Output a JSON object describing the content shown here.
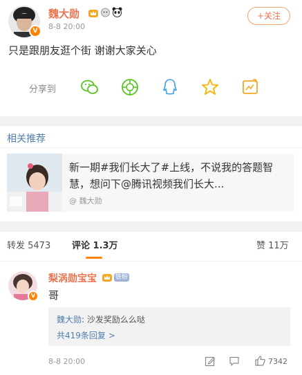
{
  "post": {
    "author": "魏大勋",
    "verified_icon": "orange-v-icon",
    "badges": [
      "vip-crown-icon",
      "sheep-icon",
      "panda-icon"
    ],
    "time": "8-8 20:00",
    "follow_label": "+关注",
    "content": "只是跟朋友逛个街 谢谢大家关心",
    "share_label": "分享到",
    "share_targets": [
      "wechat-icon",
      "moments-icon",
      "qq-icon",
      "qzone-star-icon",
      "save-icon"
    ]
  },
  "related": {
    "section_title": "相关推荐",
    "card_text": "新一期#我们长大了#上线，不说我的答题智慧，想问下@腾讯视频我们长大...",
    "card_author": "@ 魏大勋"
  },
  "tabs": {
    "repost": "转发 5473",
    "comments": "评论 1.3万",
    "likes": "赞 11万"
  },
  "comment": {
    "author": "梨涡勋宝宝",
    "badge": "铁粉",
    "text": "哥",
    "reply_author": "魏大勋",
    "reply_text": ": 沙发奖励么么哒",
    "more_replies": "共419条回复 >",
    "time": "8-8 20:00",
    "like_count": "7342"
  },
  "colors": {
    "name": "#eb7350",
    "accent": "#ff8200",
    "link": "#507daf",
    "muted": "#999999",
    "separator": "#f2f2f2"
  }
}
